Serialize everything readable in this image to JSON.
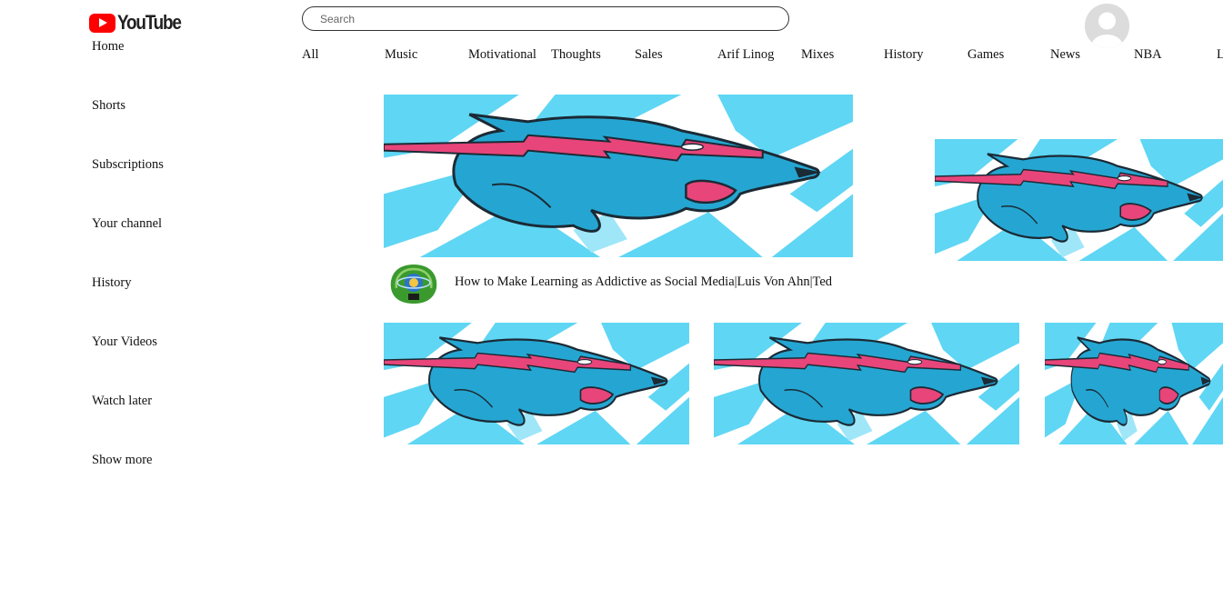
{
  "header": {
    "logo_text": "YouTube",
    "search": {
      "placeholder": "Search",
      "value": ""
    }
  },
  "sidebar": {
    "items": [
      {
        "label": "Home"
      },
      {
        "label": "Shorts"
      },
      {
        "label": "Subscriptions"
      },
      {
        "label": "Your channel"
      },
      {
        "label": "History"
      },
      {
        "label": "Your Videos"
      },
      {
        "label": "Watch later"
      },
      {
        "label": "Show more"
      }
    ]
  },
  "chips": [
    {
      "label": "All"
    },
    {
      "label": "Music"
    },
    {
      "label": "Motivational"
    },
    {
      "label": "Thoughts"
    },
    {
      "label": "Sales"
    },
    {
      "label": "Arif Linog"
    },
    {
      "label": "Mixes"
    },
    {
      "label": "History"
    },
    {
      "label": "Games"
    },
    {
      "label": "News"
    },
    {
      "label": "NBA"
    },
    {
      "label": "L"
    }
  ],
  "featured_video": {
    "title": "How to Make Learning as Addictive as Social Media|Luis Von Ahn|Ted"
  },
  "colors": {
    "brand_red": "#ff0000",
    "thumb_sky": "#5fd6f4",
    "thumb_beast": "#25a6d2",
    "thumb_bolt": "#e8457a"
  },
  "icons": {
    "logo": "youtube-play-icon",
    "avatar": "user-silhouette-icon",
    "channel": "channel-emblem-icon"
  }
}
